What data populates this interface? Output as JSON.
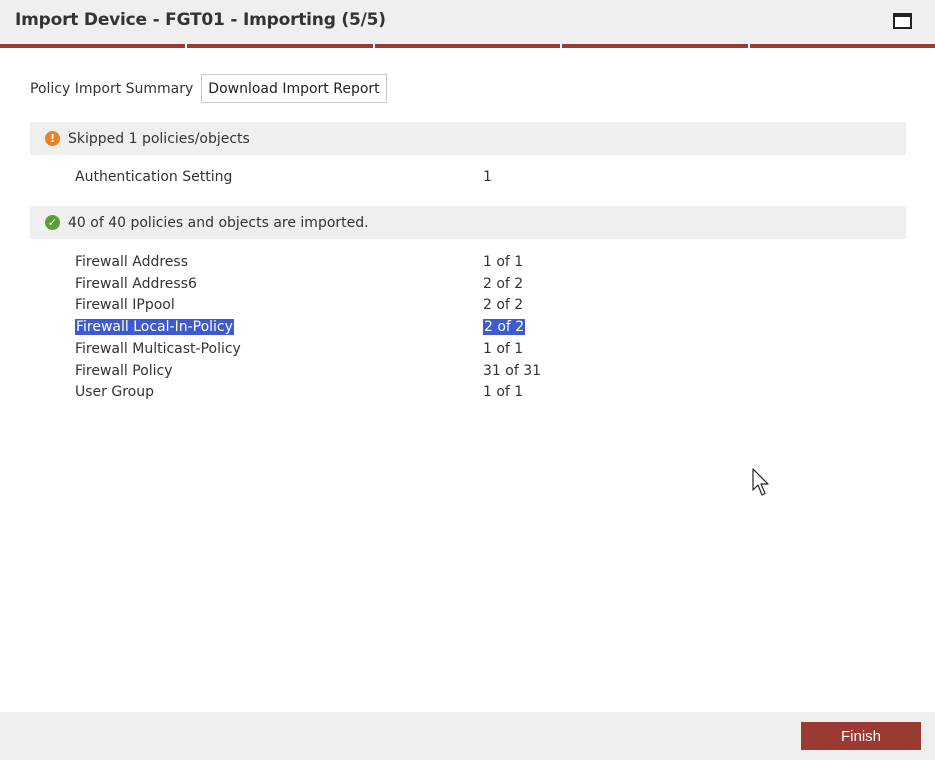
{
  "window": {
    "title": "Import Device - FGT01 - Importing (5/5)",
    "progress_steps": 5
  },
  "summary": {
    "label": "Policy Import Summary",
    "download_button": "Download Import Report"
  },
  "skipped": {
    "icon": "exclamation-icon",
    "header": "Skipped 1 policies/objects",
    "items": [
      {
        "name": "Authentication Setting",
        "count": "1"
      }
    ]
  },
  "imported": {
    "icon": "check-icon",
    "header": "40 of 40 policies and objects are imported.",
    "items": [
      {
        "name": "Firewall Address",
        "count": "1 of 1"
      },
      {
        "name": "Firewall Address6",
        "count": "2 of 2"
      },
      {
        "name": "Firewall IPpool",
        "count": "2 of 2"
      },
      {
        "name": "Firewall Local-In-Policy",
        "count": "2 of 2"
      },
      {
        "name": "Firewall Multicast-Policy",
        "count": "1 of 1"
      },
      {
        "name": "Firewall Policy",
        "count": "31 of 31"
      },
      {
        "name": "User Group",
        "count": "1 of 1"
      }
    ]
  },
  "footer": {
    "finish_button": "Finish"
  },
  "colors": {
    "accent": "#9b3a32",
    "warning": "#f07f1d",
    "success": "#5b9e35",
    "selection": "#3d5ad0"
  }
}
